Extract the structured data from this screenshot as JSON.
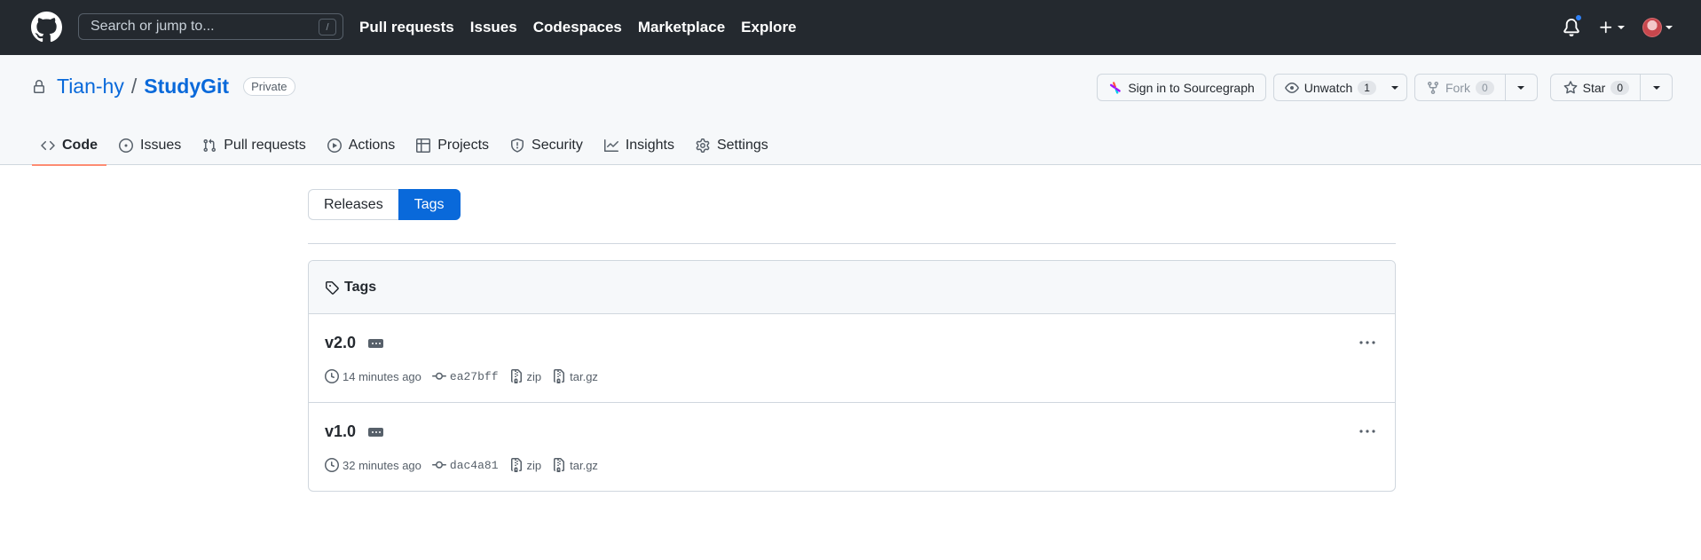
{
  "header": {
    "search_placeholder": "Search or jump to...",
    "search_shortcut": "/",
    "nav": [
      "Pull requests",
      "Issues",
      "Codespaces",
      "Marketplace",
      "Explore"
    ]
  },
  "repo": {
    "owner": "Tian-hy",
    "separator": "/",
    "name": "StudyGit",
    "visibility": "Private",
    "actions": {
      "sourcegraph": "Sign in to Sourcegraph",
      "watch_label": "Unwatch",
      "watch_count": "1",
      "fork_label": "Fork",
      "fork_count": "0",
      "star_label": "Star",
      "star_count": "0"
    },
    "tabs": [
      {
        "label": "Code",
        "selected": true
      },
      {
        "label": "Issues"
      },
      {
        "label": "Pull requests"
      },
      {
        "label": "Actions"
      },
      {
        "label": "Projects"
      },
      {
        "label": "Security"
      },
      {
        "label": "Insights"
      },
      {
        "label": "Settings"
      }
    ]
  },
  "switch": {
    "releases": "Releases",
    "tags": "Tags",
    "active": "Tags"
  },
  "tags_box": {
    "title": "Tags",
    "rows": [
      {
        "name": "v2.0",
        "time": "14 minutes ago",
        "sha": "ea27bff",
        "zip": "zip",
        "targz": "tar.gz"
      },
      {
        "name": "v1.0",
        "time": "32 minutes ago",
        "sha": "dac4a81",
        "zip": "zip",
        "targz": "tar.gz"
      }
    ]
  },
  "colors": {
    "header_bg": "#24292f",
    "link": "#0969da",
    "tab_underline": "#fd8c73",
    "notification_dot": "#2f81f7"
  }
}
